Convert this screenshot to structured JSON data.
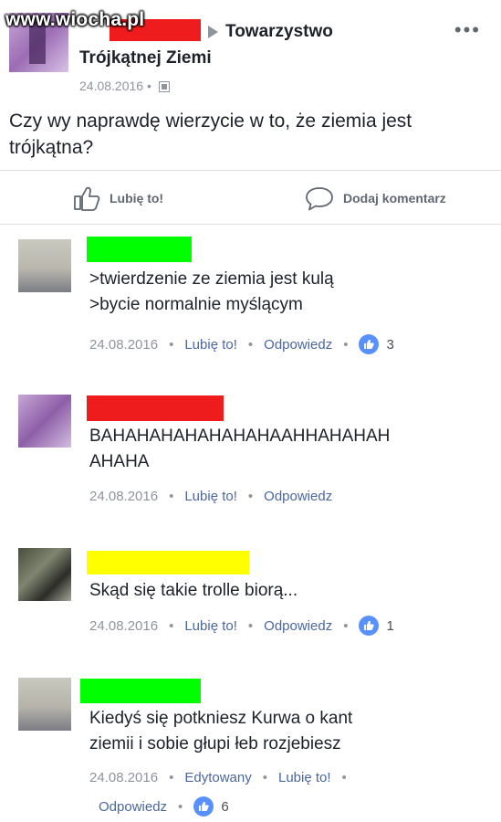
{
  "watermark": {
    "text": "www.wiocha.pl"
  },
  "post": {
    "group_line1": "Towarzystwo",
    "group_line2": "Trójkątnej Ziemi",
    "date": "24.08.2016",
    "separator": "•",
    "more": "•••",
    "text": "Czy wy naprawdę wierzycie w to, że ziemia jest trójkątna?",
    "like_label": "Lubię to!",
    "comment_label": "Dodaj komentarz"
  },
  "colors": {
    "link": "#4b67a1",
    "like_badge": "#5890ff",
    "redact_green": "#00ff00",
    "redact_red": "#ee1c1c",
    "redact_yellow": "#ffff00"
  },
  "comments": [
    {
      "text_line1": ">twierdzenie ze ziemia jest kulą",
      "text_line2": ">bycie normalnie myślącym",
      "date": "24.08.2016",
      "like": "Lubię to!",
      "reply": "Odpowiedz",
      "likes": "3"
    },
    {
      "text_line1": "BAHAHAHAHAHAHAHAAHHAHAHAH",
      "text_line2": "AHAHA",
      "date": "24.08.2016",
      "like": "Lubię to!",
      "reply": "Odpowiedz"
    },
    {
      "text_line1": "Skąd się takie trolle biorą...",
      "date": "24.08.2016",
      "like": "Lubię to!",
      "reply": "Odpowiedz",
      "likes": "1"
    },
    {
      "text_line1": "Kiedyś się potkniesz Kurwa o kant",
      "text_line2": "ziemii i sobie głupi łeb rozjebiesz",
      "date": "24.08.2016",
      "edited": "Edytowany",
      "like": "Lubię to!",
      "reply": "Odpowiedz",
      "likes": "6"
    }
  ]
}
